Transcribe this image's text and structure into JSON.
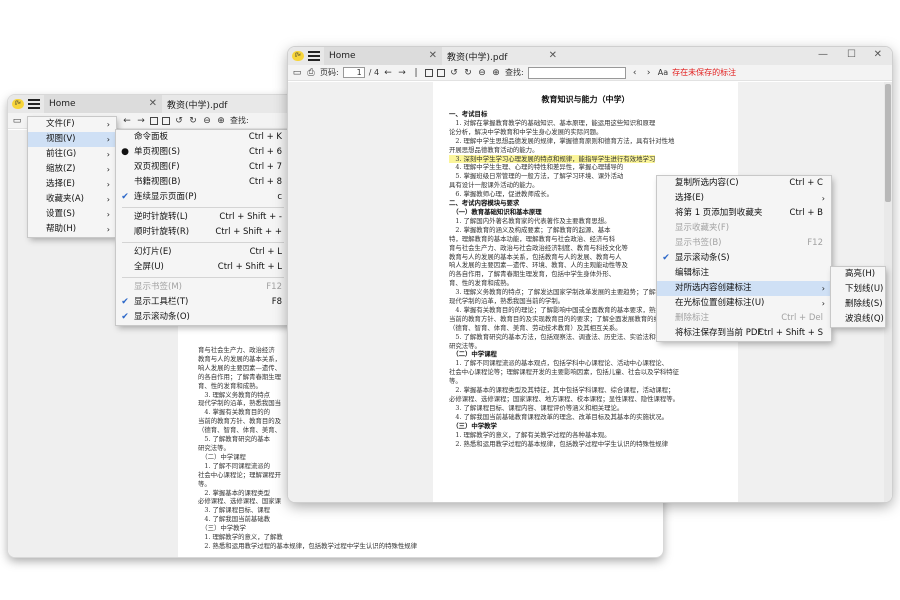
{
  "back_window": {
    "tab_home": "Home",
    "tab_doc": "教资(中学).pdf",
    "search_label": "查找:",
    "app_logo": "ffw",
    "main_menu": [
      {
        "label": "文件(F)",
        "arrow": "›"
      },
      {
        "label": "视图(V)",
        "arrow": "›"
      },
      {
        "label": "前往(G)",
        "arrow": "›"
      },
      {
        "label": "缩放(Z)",
        "arrow": "›"
      },
      {
        "label": "选择(E)",
        "arrow": "›"
      },
      {
        "label": "收藏夹(A)",
        "arrow": "›"
      },
      {
        "label": "设置(S)",
        "arrow": "›"
      },
      {
        "label": "帮助(H)",
        "arrow": "›"
      }
    ],
    "view_menu": [
      {
        "label": "命令面板",
        "shortcut": "Ctrl + K",
        "check": "",
        "disabled": false
      },
      {
        "label": "单页视图(S)",
        "shortcut": "Ctrl + 6",
        "check": "●",
        "disabled": false
      },
      {
        "label": "双页视图(F)",
        "shortcut": "Ctrl + 7",
        "check": "",
        "disabled": false
      },
      {
        "label": "书籍视图(B)",
        "shortcut": "Ctrl + 8",
        "check": "",
        "disabled": false
      },
      {
        "label": "连续显示页面(P)",
        "shortcut": "c",
        "check": "✔",
        "disabled": false
      },
      {
        "sep": true
      },
      {
        "label": "逆时针旋转(L)",
        "shortcut": "Ctrl + Shift + -",
        "check": "",
        "disabled": false
      },
      {
        "label": "顺时针旋转(R)",
        "shortcut": "Ctrl + Shift + +",
        "check": "",
        "disabled": false
      },
      {
        "sep": true
      },
      {
        "label": "幻灯片(E)",
        "shortcut": "Ctrl + L",
        "check": "",
        "disabled": false
      },
      {
        "label": "全屏(U)",
        "shortcut": "Ctrl + Shift + L",
        "check": "",
        "disabled": false
      },
      {
        "sep": true
      },
      {
        "label": "显示书签(M)",
        "shortcut": "F12",
        "check": "",
        "disabled": true
      },
      {
        "label": "显示工具栏(T)",
        "shortcut": "F8",
        "check": "✔",
        "disabled": false
      },
      {
        "label": "显示滚动条(O)",
        "shortcut": "",
        "check": "✔",
        "disabled": false
      }
    ],
    "page_lines": [
      "育与社会生产力、政治经济",
      "教育与人的发展的基本关系，",
      "响人发展的主要因素—遗传、",
      "的各自作用；了解青春期生理",
      "育、性的发育和成熟。",
      "　3. 理解义务教育的特点",
      "现代学制的沿革，熟悉我国当",
      "　4. 掌握有关教育目的的",
      "当前的教育方针、教育目的及",
      "（德育、智育、体育、美育、",
      "　5. 了解教育研究的基本",
      "研究法等。",
      "　（二）中学课程",
      "　1. 了解不同课程流派的",
      "社会中心课程论；理解课程开",
      "等。",
      "　2. 掌握基本的课程类型",
      "必修课程、选修课程、国家课",
      "　3. 了解课程目标、课程",
      "　4. 了解我国当前基础教",
      "　（三）中学教学",
      "　1. 理解教学的意义，了解教",
      "　2. 熟悉和运用教学过程的基本规律，包括教学过程中学生认识的特殊性规律"
    ]
  },
  "front_window": {
    "tab_home": "Home",
    "tab_doc": "教资(中学).pdf",
    "app_logo": "ffw",
    "page_label": "页码:",
    "page_current": "1",
    "page_total": "/ 4",
    "search_label": "查找:",
    "font_size_label": "Aa",
    "unsaved_notice": "存在未保存的标注",
    "page_title": "教育知识与能力（中学）",
    "page_lines": [
      {
        "text": "一、考试目标",
        "h": true
      },
      {
        "text": "　1. 对解在掌握教育教学的基础知识、基本原理，能运用这些知识和原理"
      },
      {
        "text": "论分析，解决中学教育和中学生身心发展的实际问题。"
      },
      {
        "text": "　2. 理解中学生思想品德发展的规律，掌握德育原则和德育方法，具有针对性地"
      },
      {
        "text": "开展思想品德教育活动的能力。"
      },
      {
        "text": "　3. 深刻中学生学习心理发展的特点和规律，能指导学生进行有效地学习",
        "hl": true
      },
      {
        "text": "　4. 理解中学生生理、心理的特性和差异性，掌握心理辅导的"
      },
      {
        "text": "　5. 掌握班级日常管理的一般方法，了解学习环境、课外活动"
      },
      {
        "text": "具有设计一般课外活动的能力。"
      },
      {
        "text": "　6. 掌握教师心理，促进教师成长。"
      },
      {
        "text": " "
      },
      {
        "text": "二、考试内容模块与要求",
        "h": true
      },
      {
        "text": "　（一）教育基础知识和基本原理",
        "h": true
      },
      {
        "text": "　1. 了解国内外著名教育家的代表著作及主要教育思想。"
      },
      {
        "text": "　2. 掌握教育的涵义及构成要素；了解教育的起源、基本"
      },
      {
        "text": "特，理解教育的基本功能，理解教育与社会政治、经济与科"
      },
      {
        "text": "育与社会生产力、政治与社会政治经济制度、教育与科技文化等"
      },
      {
        "text": "教育与人的发展的基本关系，包括教育与人的发展、教育与人"
      },
      {
        "text": "响人发展的主要因素—遗传、环境、教育、人的主观能动性等及"
      },
      {
        "text": "的各自作用，了解青春期生理发育，包括中学生身体外形、"
      },
      {
        "text": "育、性的发育和成熟。"
      },
      {
        "text": "　3. 理解义务教育的特点；了解发达国家学制改革发展的主要趋势；了解我国"
      },
      {
        "text": "现代学制的沿革，熟悉我国当前的学制。"
      },
      {
        "text": "　4. 掌握有关教育目的的理论；了解影响中国或全面教育的基本要求，熟悉我国"
      },
      {
        "text": "当前的教育方针、教育目的及实现教育目的的要求；了解全面发展教育的组成部分"
      },
      {
        "text": "（德育、智育、体育、美育、劳动技术教育）及其相互关系。"
      },
      {
        "text": "　5. 了解教育研究的基本方法，包括观察法、调查法、历史法、实验法和行动"
      },
      {
        "text": "研究法等。"
      },
      {
        "text": "　（二）中学课程",
        "h": true
      },
      {
        "text": "　1. 了解不同课程流派的基本观点，包括学科中心课程论、活动中心课程论、"
      },
      {
        "text": "社会中心课程论等；理解课程开发的主要影响因素，包括儿童、社会以及学科特征"
      },
      {
        "text": "等。"
      },
      {
        "text": "　2. 掌握基本的课程类型及其特征，其中包括学科课程、综合课程，活动课程；"
      },
      {
        "text": "必修课程、选修课程；国家课程、地方课程、校本课程；显性课程、隐性课程等。"
      },
      {
        "text": "　3. 了解课程目标、课程内容、课程评价等涵义和相关理论。"
      },
      {
        "text": "　4. 了解我国当前基础教育课程改革的理念、改革目标及其基本的实施状况。"
      },
      {
        "text": "　（三）中学教学",
        "h": true
      },
      {
        "text": "　1. 理解教学的意义，了解有关教学过程的各种基本观。"
      },
      {
        "text": "　2. 熟悉和运用教学过程的基本规律，包括教学过程中学生认识的特殊性规律"
      }
    ],
    "context_menu": [
      {
        "label": "复制所选内容(C)",
        "shortcut": "Ctrl + C",
        "disabled": false,
        "check": "",
        "arrow": ""
      },
      {
        "label": "选择(E)",
        "shortcut": "",
        "disabled": false,
        "check": "",
        "arrow": "›"
      },
      {
        "label": "将第 1 页添加到收藏夹",
        "shortcut": "Ctrl + B",
        "disabled": false,
        "check": "",
        "arrow": ""
      },
      {
        "label": "显示收藏夹(F)",
        "shortcut": "",
        "disabled": true,
        "check": "",
        "arrow": ""
      },
      {
        "label": "显示书签(B)",
        "shortcut": "F12",
        "disabled": true,
        "check": "",
        "arrow": ""
      },
      {
        "label": "显示滚动条(S)",
        "shortcut": "",
        "disabled": false,
        "check": "✔",
        "arrow": ""
      },
      {
        "label": "编辑标注",
        "shortcut": "",
        "disabled": false,
        "check": "",
        "arrow": ""
      },
      {
        "label": "对所选内容创建标注",
        "shortcut": "",
        "disabled": false,
        "check": "",
        "arrow": "›",
        "selected": true
      },
      {
        "label": "在光标位置创建标注(U)",
        "shortcut": "",
        "disabled": false,
        "check": "",
        "arrow": "›"
      },
      {
        "label": "删除标注",
        "shortcut": "Ctrl + Del",
        "disabled": true,
        "check": "",
        "arrow": ""
      },
      {
        "label": "将标注保存到当前 PDF",
        "shortcut": "Ctrl + Shift + S",
        "disabled": false,
        "check": "",
        "arrow": ""
      }
    ],
    "annotation_submenu": [
      {
        "label": "高亮(H)"
      },
      {
        "label": "下划线(U)"
      },
      {
        "label": "删除线(S)"
      },
      {
        "label": "波浪线(Q)"
      }
    ]
  }
}
